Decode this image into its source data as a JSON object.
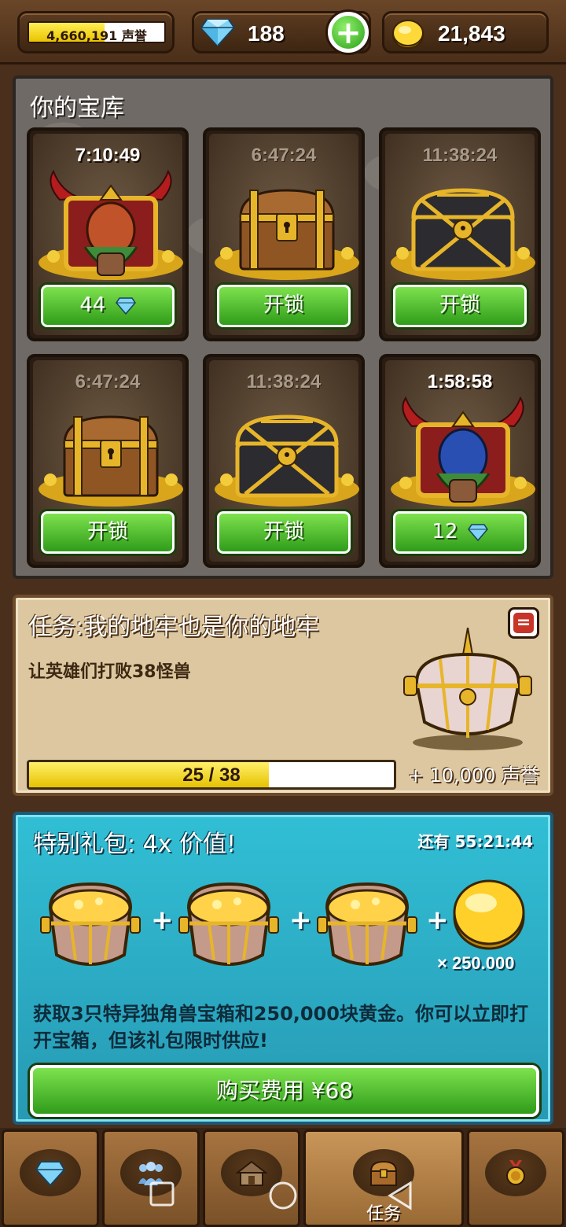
{
  "topbar": {
    "reputation_text": "4,660,191 声誉",
    "reputation_fill": 0.56,
    "gems": "188",
    "gold": "21,843"
  },
  "vault": {
    "title": "你的宝库",
    "cards": [
      {
        "timer": "7:10:49",
        "active": true,
        "chest": "demon-chest",
        "button": "44",
        "button_gem": true
      },
      {
        "timer": "6:47:24",
        "active": false,
        "chest": "wooden-chest",
        "button": "开锁",
        "button_gem": false
      },
      {
        "timer": "11:38:24",
        "active": false,
        "chest": "iron-chest",
        "button": "开锁",
        "button_gem": false
      },
      {
        "timer": "6:47:24",
        "active": false,
        "chest": "wooden-chest",
        "button": "开锁",
        "button_gem": false
      },
      {
        "timer": "11:38:24",
        "active": false,
        "chest": "iron-chest",
        "button": "开锁",
        "button_gem": false
      },
      {
        "timer": "1:58:58",
        "active": true,
        "chest": "demon-chest",
        "button": "12",
        "button_gem": true
      }
    ]
  },
  "quest": {
    "title": "任务:我的地牢也是你的地牢",
    "description": "让英雄们打败38怪兽",
    "progress_text": "25 / 38",
    "progress_fraction": 0.658,
    "reward": "+ 10,000 声誉"
  },
  "offer": {
    "title": "特别礼包: 4x 价值!",
    "timer": "还有 55:21:44",
    "coin_quantity": "× 250.000",
    "description": "获取3只特异独角兽宝箱和250,000块黄金。你可以立即打开宝箱，但该礼包限时供应!",
    "buy_label": "购买费用 ¥68"
  },
  "nav": {
    "tabs": [
      {
        "icon": "gem-icon",
        "label": ""
      },
      {
        "icon": "people-icon",
        "label": ""
      },
      {
        "icon": "house-icon",
        "label": ""
      },
      {
        "icon": "chest-icon",
        "label": "任务",
        "active": true
      },
      {
        "icon": "medal-icon",
        "label": ""
      }
    ]
  },
  "colors": {
    "green_button": "#3fb524",
    "offer_bg": "#2fb6cf",
    "quest_bg": "#dcc7a0",
    "wood": "#7a5128"
  }
}
